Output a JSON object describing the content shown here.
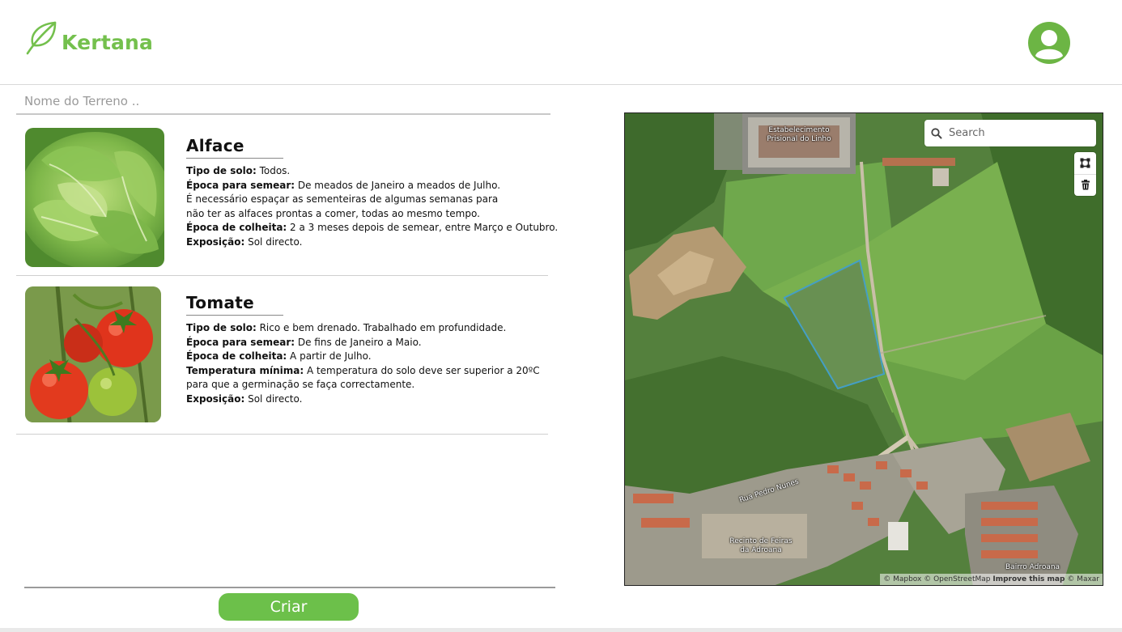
{
  "header": {
    "logo_text": "Kertana",
    "brand_color": "#74c04d"
  },
  "terrain_input": {
    "placeholder": "Nome do Terreno ..",
    "value": ""
  },
  "plants": [
    {
      "name": "Alface",
      "lines": [
        {
          "label": "Tipo de solo:",
          "text": " Todos."
        },
        {
          "label": "Época para semear:",
          "text": " De meados de Janeiro a meados de Julho."
        },
        {
          "label": "",
          "text": "É necessário espaçar as sementeiras de algumas semanas para"
        },
        {
          "label": "",
          "text": "não ter as alfaces prontas a comer, todas ao mesmo tempo."
        },
        {
          "label": "Época de colheita:",
          "text": " 2 a 3 meses depois de semear, entre Março e Outubro."
        },
        {
          "label": "Exposição:",
          "text": " Sol directo."
        }
      ]
    },
    {
      "name": "Tomate",
      "lines": [
        {
          "label": "Tipo de solo:",
          "text": " Rico e bem drenado. Trabalhado em profundidade."
        },
        {
          "label": "Época para semear:",
          "text": " De fins de Janeiro a Maio."
        },
        {
          "label": "Época de colheita:",
          "text": " A partir de Julho."
        },
        {
          "label": "Temperatura mínima:",
          "text": " A temperatura do solo deve ser superior a 20ºC"
        },
        {
          "label": "",
          "text": "para que a germinação se faça correctamente."
        },
        {
          "label": "Exposição:",
          "text": " Sol directo."
        }
      ]
    }
  ],
  "actions": {
    "create_label": "Criar",
    "button_color": "#6cc04a"
  },
  "map": {
    "search_placeholder": "Search",
    "labels": {
      "prison": "Estabelecimento\nPrisional do Linho",
      "street": "Rua Pedro Nunes",
      "fair": "Recinto de Feiras\nda Adroana",
      "neighborhood": "Bairro Adroana"
    },
    "attribution": {
      "mapbox": "© Mapbox",
      "osm": "© OpenStreetMap",
      "improve": "Improve this map",
      "maxar": "© Maxar"
    },
    "polygon_color": "#3aa0d8"
  }
}
